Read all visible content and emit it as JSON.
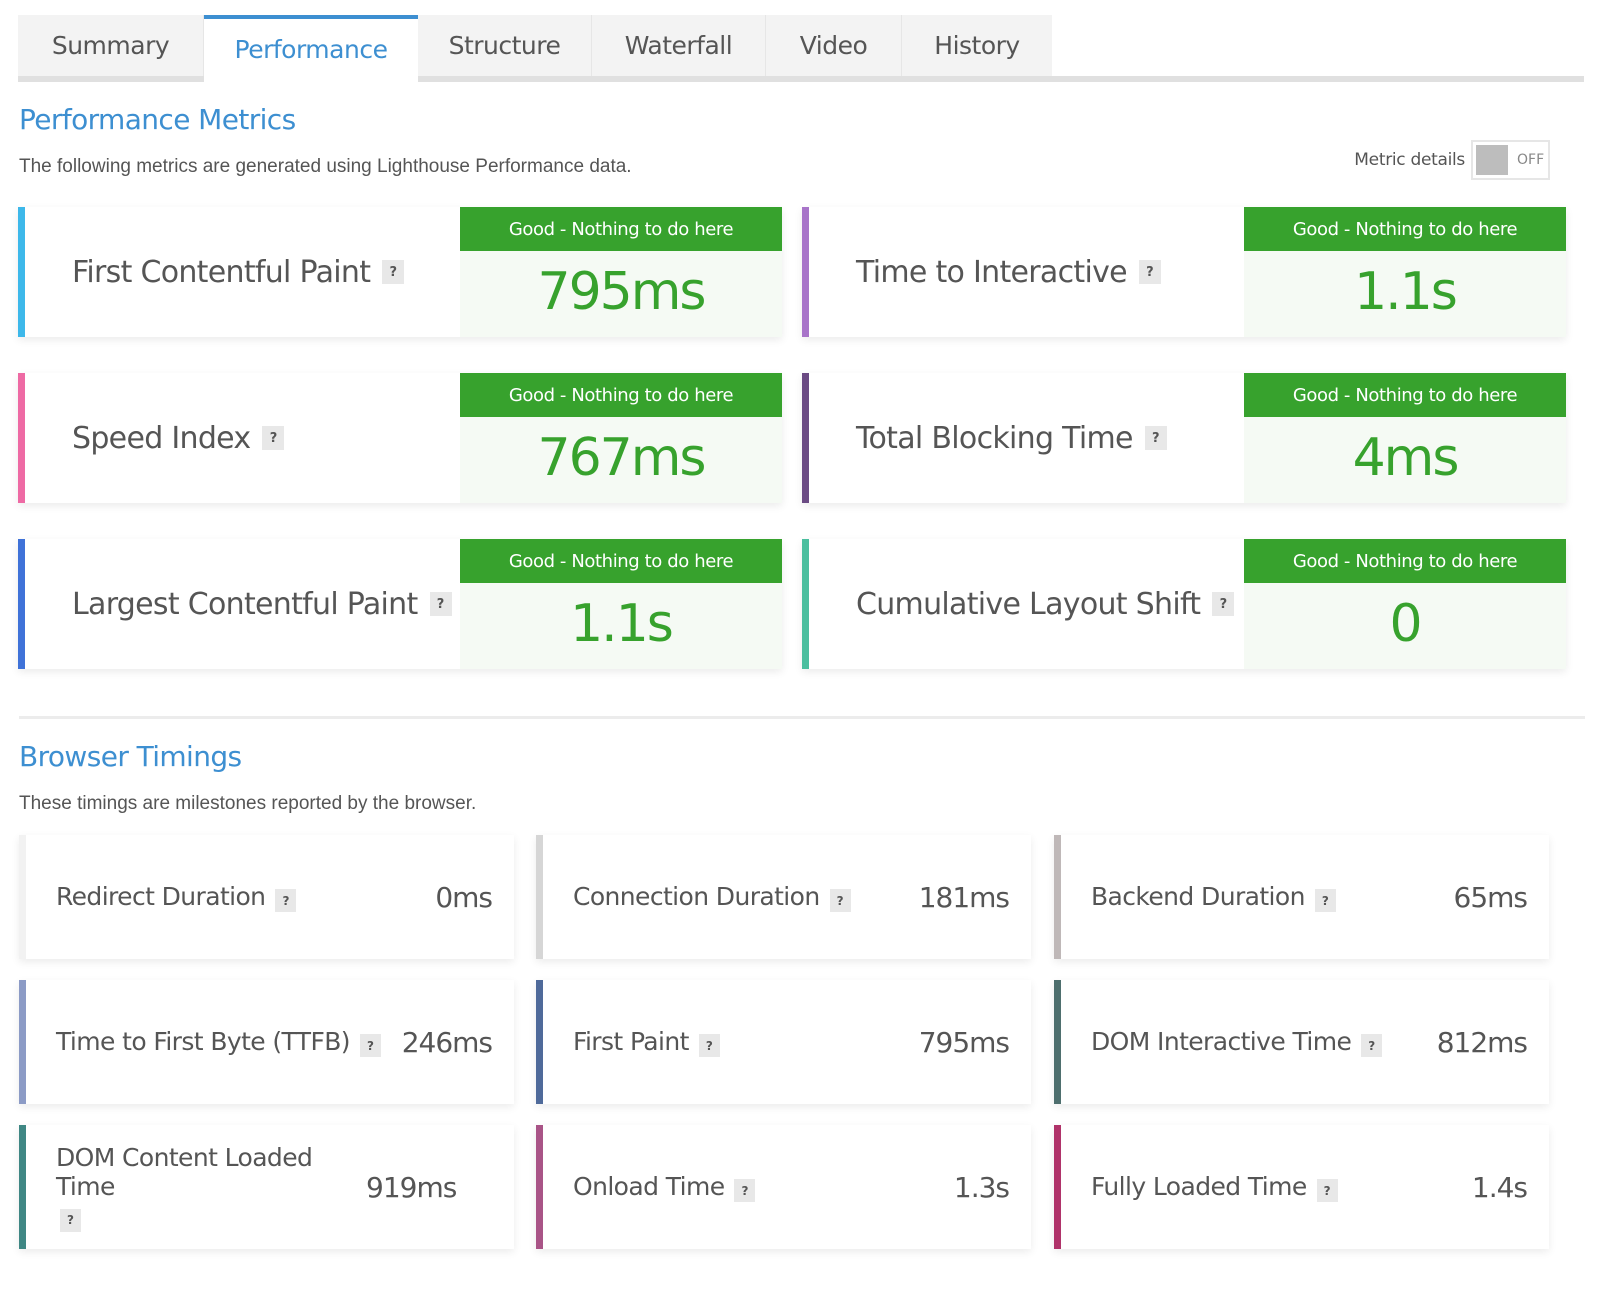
{
  "tabs": [
    {
      "label": "Summary",
      "active": false
    },
    {
      "label": "Performance",
      "active": true
    },
    {
      "label": "Structure",
      "active": false
    },
    {
      "label": "Waterfall",
      "active": false
    },
    {
      "label": "Video",
      "active": false
    },
    {
      "label": "History",
      "active": false
    }
  ],
  "performance": {
    "title": "Performance Metrics",
    "subtitle": "The following metrics are generated using Lighthouse Performance data.",
    "toggle": {
      "label": "Metric details",
      "state": "OFF"
    },
    "help_icon": "?",
    "metrics": [
      {
        "label": "First Contentful Paint",
        "grade": "Good - Nothing to do here",
        "value": "795ms",
        "color": "#3db8ea"
      },
      {
        "label": "Time to Interactive",
        "grade": "Good - Nothing to do here",
        "value": "1.1s",
        "color": "#a874c9"
      },
      {
        "label": "Speed Index",
        "grade": "Good - Nothing to do here",
        "value": "767ms",
        "color": "#ee6aa4"
      },
      {
        "label": "Total Blocking Time",
        "grade": "Good - Nothing to do here",
        "value": "4ms",
        "color": "#6b4b84"
      },
      {
        "label": "Largest Contentful Paint",
        "grade": "Good - Nothing to do here",
        "value": "1.1s",
        "color": "#3f72d8"
      },
      {
        "label": "Cumulative Layout Shift",
        "grade": "Good - Nothing to do here",
        "value": "0",
        "color": "#4bbf9f"
      }
    ],
    "grade_color": "#37a22d"
  },
  "browser": {
    "title": "Browser Timings",
    "subtitle": "These timings are milestones reported by the browser.",
    "timings": [
      {
        "label": "Redirect Duration",
        "value": "0ms",
        "color": "#f2f2f2"
      },
      {
        "label": "Connection Duration",
        "value": "181ms",
        "color": "#d6d6d6"
      },
      {
        "label": "Backend Duration",
        "value": "65ms",
        "color": "#bfb8b8"
      },
      {
        "label": "Time to First Byte (TTFB)",
        "value": "246ms",
        "color": "#8c9bc6"
      },
      {
        "label": "First Paint",
        "value": "795ms",
        "color": "#4f6a9a"
      },
      {
        "label": "DOM Interactive Time",
        "value": "812ms",
        "color": "#4e6f6e"
      },
      {
        "label": "DOM Content Loaded Time",
        "value": "919ms",
        "color": "#3f8784"
      },
      {
        "label": "Onload Time",
        "value": "1.3s",
        "color": "#a95487"
      },
      {
        "label": "Fully Loaded Time",
        "value": "1.4s",
        "color": "#b0336a"
      }
    ]
  }
}
